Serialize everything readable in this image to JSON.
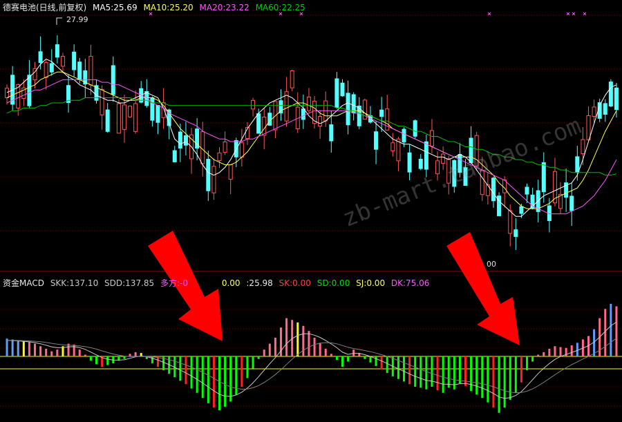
{
  "legend_top": {
    "title": "德赛电池(日线,前复权)",
    "ma5": "MA5:25.69",
    "ma10": "MA10:25.20",
    "ma20": "MA20:23.22",
    "ma60": "MA60:22.25"
  },
  "legend_bottom": {
    "title": "资金MACD",
    "skk": "SKK:137.10",
    "sdd": "SDD:137.85",
    "duofang": "多方:-0",
    "v1": "0.00",
    "v2": ":25.98",
    "sk": "SK:0.00",
    "sd": "SD:0.00",
    "sj": "SJ:0.00",
    "dk": "DK:75.06"
  },
  "annotations": {
    "high": "27.99",
    "low": "00"
  },
  "watermark": "zb-mart.taobao.com",
  "colors": {
    "up": "#ff5555",
    "down": "#54ffff",
    "ma5": "#ffffff",
    "ma10": "#ffff54",
    "ma20": "#ff54ff",
    "ma60": "#00c000",
    "macd_green": "#00ff00",
    "macd_red": "#ff2020",
    "macd_blue": "#5aa0ff",
    "macd_pink": "#ff6a8a",
    "macd_yellow": "#ffff00",
    "arrow": "#ff0000"
  },
  "chart_data": [
    {
      "type": "candlestick",
      "ylim": [
        18.6,
        28.4
      ],
      "n": 110,
      "high_value": 27.99,
      "series": [
        {
          "name": "MA5",
          "values": [
            25.4,
            25.5,
            25.6,
            25.8,
            26.0,
            26.2,
            26.5,
            26.7,
            26.6,
            26.4,
            26.2,
            26.0,
            25.9,
            25.7,
            25.6,
            25.5,
            25.3,
            25.2,
            25.1,
            25.1,
            25.0,
            25.0,
            25.1,
            25.2,
            25.3,
            25.4,
            25.3,
            25.2,
            24.8,
            24.2,
            23.6,
            23.4,
            23.5,
            23.3,
            23.0,
            22.6,
            22.3,
            22.2,
            22.3,
            22.5,
            22.8,
            23.2,
            23.6,
            24.0,
            24.3,
            24.6,
            24.8,
            25.0,
            25.1,
            25.2,
            25.3,
            25.2,
            25.0,
            24.8,
            24.5,
            24.3,
            24.2,
            24.3,
            24.5,
            24.7,
            24.9,
            25.0,
            24.9,
            24.8,
            24.6,
            24.4,
            24.2,
            24.0,
            23.8,
            23.6,
            23.5,
            23.4,
            23.4,
            23.3,
            23.2,
            23.1,
            23.0,
            22.9,
            22.9,
            22.8,
            22.9,
            23.0,
            22.9,
            22.7,
            22.4,
            22.1,
            21.8,
            21.5,
            21.2,
            21.0,
            20.8,
            20.6,
            20.6,
            20.8,
            21.0,
            21.2,
            21.4,
            21.5,
            21.6,
            21.7,
            21.8,
            21.9,
            22.2,
            22.8,
            23.5,
            24.2,
            24.9,
            25.3,
            25.6,
            25.7
          ]
        },
        {
          "name": "MA10",
          "values": [
            25.2,
            25.3,
            25.4,
            25.5,
            25.6,
            25.7,
            25.9,
            26.0,
            26.1,
            26.2,
            26.2,
            26.1,
            26.0,
            25.9,
            25.8,
            25.7,
            25.6,
            25.5,
            25.4,
            25.3,
            25.2,
            25.1,
            25.1,
            25.1,
            25.2,
            25.2,
            25.2,
            25.1,
            24.9,
            24.6,
            24.3,
            24.0,
            23.8,
            23.6,
            23.4,
            23.2,
            23.0,
            22.8,
            22.7,
            22.6,
            22.6,
            22.7,
            22.9,
            23.1,
            23.4,
            23.7,
            24.0,
            24.3,
            24.5,
            24.7,
            24.8,
            24.9,
            25.0,
            25.0,
            24.9,
            24.8,
            24.6,
            24.5,
            24.5,
            24.5,
            24.6,
            24.7,
            24.7,
            24.7,
            24.6,
            24.5,
            24.4,
            24.3,
            24.2,
            24.0,
            23.9,
            23.8,
            23.7,
            23.6,
            23.5,
            23.4,
            23.3,
            23.2,
            23.1,
            23.0,
            22.9,
            22.9,
            22.9,
            22.9,
            22.8,
            22.6,
            22.4,
            22.2,
            21.9,
            21.7,
            21.4,
            21.2,
            21.0,
            20.9,
            20.9,
            20.9,
            21.0,
            21.1,
            21.3,
            21.4,
            21.5,
            21.6,
            21.7,
            22.0,
            22.4,
            22.9,
            23.4,
            23.9,
            24.3,
            24.7
          ]
        },
        {
          "name": "MA20",
          "values": [
            25.0,
            25.1,
            25.2,
            25.3,
            25.4,
            25.5,
            25.5,
            25.6,
            25.7,
            25.8,
            25.9,
            25.9,
            25.9,
            25.9,
            25.9,
            25.9,
            25.9,
            25.8,
            25.8,
            25.7,
            25.7,
            25.6,
            25.5,
            25.4,
            25.3,
            25.2,
            25.0,
            24.9,
            24.8,
            24.6,
            24.5,
            24.4,
            24.3,
            24.2,
            24.1,
            23.9,
            23.8,
            23.7,
            23.6,
            23.6,
            23.5,
            23.5,
            23.5,
            23.6,
            23.6,
            23.7,
            23.8,
            23.9,
            24.0,
            24.1,
            24.2,
            24.3,
            24.4,
            24.5,
            24.6,
            24.7,
            24.7,
            24.7,
            24.7,
            24.7,
            24.7,
            24.7,
            24.6,
            24.6,
            24.5,
            24.4,
            24.3,
            24.2,
            24.1,
            24.0,
            23.9,
            23.8,
            23.7,
            23.6,
            23.5,
            23.4,
            23.3,
            23.2,
            23.1,
            23.0,
            22.9,
            22.8,
            22.7,
            22.6,
            22.5,
            22.4,
            22.3,
            22.2,
            22.1,
            22.0,
            21.8,
            21.6,
            21.4,
            21.2,
            21.0,
            20.9,
            20.8,
            20.7,
            20.7,
            20.7,
            20.7,
            20.8,
            20.9,
            21.0,
            21.2,
            21.4,
            21.7,
            22.0,
            22.4,
            22.8
          ]
        },
        {
          "name": "MA60",
          "values": [
            24.6,
            24.7,
            24.7,
            24.8,
            24.8,
            24.8,
            24.9,
            24.9,
            25.0,
            25.0,
            25.0,
            25.1,
            25.1,
            25.1,
            25.2,
            25.2,
            25.2,
            25.2,
            25.2,
            25.2,
            25.2,
            25.2,
            25.2,
            25.1,
            25.1,
            25.1,
            25.0,
            25.0,
            25.0,
            24.9,
            24.9,
            24.9,
            24.9,
            24.9,
            24.9,
            24.9,
            24.9,
            24.9,
            24.9,
            24.9,
            24.9,
            24.9,
            24.9,
            24.9,
            24.9,
            24.9,
            24.9,
            24.9,
            24.9,
            24.9,
            24.9,
            24.9,
            24.9,
            24.9,
            24.9,
            24.9,
            24.9,
            24.9,
            24.9,
            24.8,
            24.8,
            24.7,
            24.7,
            24.6,
            24.5,
            24.5,
            24.4,
            24.3,
            24.3,
            24.2,
            24.1,
            24.1,
            24.0,
            23.9,
            23.9,
            23.8,
            23.7,
            23.7,
            23.6,
            23.5,
            23.5,
            23.4,
            23.3,
            23.3,
            23.2,
            23.2,
            23.1,
            23.0,
            23.0,
            22.9,
            22.9,
            22.8,
            22.8,
            22.7,
            22.7,
            22.6,
            22.6,
            22.5,
            22.5,
            22.4,
            22.4,
            22.3,
            22.3,
            22.3,
            22.3,
            22.3,
            22.3,
            22.2,
            22.2,
            22.25
          ]
        }
      ]
    },
    {
      "type": "bar",
      "ylim": [
        -7,
        7
      ],
      "values": [
        2.1,
        2.0,
        1.9,
        1.8,
        1.7,
        1.5,
        1.2,
        0.9,
        0.6,
        0.8,
        1.2,
        1.5,
        1.4,
        0.8,
        0.2,
        -0.5,
        -0.9,
        -1.2,
        -1.0,
        -0.8,
        -0.5,
        -0.3,
        0.3,
        0.5,
        0.4,
        -0.3,
        -0.8,
        -1.2,
        -1.6,
        -2.0,
        -2.4,
        -2.8,
        -3.2,
        -3.7,
        -4.2,
        -4.8,
        -5.4,
        -5.9,
        -6.2,
        -5.8,
        -5.2,
        -4.4,
        -3.5,
        -2.5,
        -1.4,
        -0.3,
        0.8,
        1.5,
        2.2,
        3.4,
        4.5,
        4.3,
        4.0,
        3.6,
        3.0,
        2.2,
        1.6,
        0.9,
        0.3,
        -0.4,
        -1.2,
        -0.6,
        0.8,
        0.4,
        -0.3,
        -0.7,
        -1.1,
        -1.5,
        -1.9,
        -2.3,
        -2.6,
        -2.9,
        -3.2,
        -3.5,
        -3.6,
        -3.8,
        -3.5,
        -3.9,
        -4.2,
        -3.6,
        -3.8,
        -3.1,
        -3.4,
        -4.0,
        -4.4,
        -4.8,
        -5.3,
        -5.9,
        -6.5,
        -5.9,
        -5.0,
        -4.2,
        -3.0,
        -1.6,
        -0.6,
        0.2,
        0.5,
        0.9,
        1.2,
        1.1,
        1.0,
        1.3,
        1.6,
        2.0,
        2.4,
        3.2,
        4.5,
        5.6,
        6.2,
        5.9
      ]
    }
  ]
}
